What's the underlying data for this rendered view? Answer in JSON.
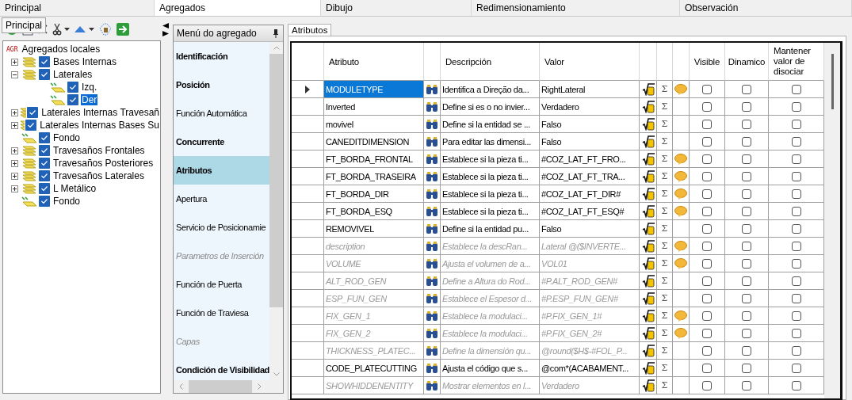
{
  "tabs": [
    {
      "label": "Principal",
      "selected": false
    },
    {
      "label": "Agregados",
      "selected": true
    },
    {
      "label": "Dibujo",
      "selected": false
    },
    {
      "label": "Redimensionamiento",
      "selected": false
    },
    {
      "label": "Observación",
      "selected": false
    }
  ],
  "tooltip": "Principal",
  "tree": {
    "root": {
      "badge": "AGR",
      "label": "Agregados locales"
    },
    "items": [
      {
        "label": "Bases Internas",
        "kind": "group",
        "expanded": false,
        "checked": true,
        "selected": false
      },
      {
        "label": "Laterales",
        "kind": "group",
        "expanded": true,
        "checked": true,
        "selected": false,
        "children": [
          {
            "label": "Izq.",
            "kind": "leaf",
            "checked": true,
            "selected": false
          },
          {
            "label": "Der",
            "kind": "leaf",
            "checked": true,
            "selected": true
          }
        ]
      },
      {
        "label": "Laterales Internas Travesañ",
        "kind": "group",
        "expanded": false,
        "checked": true,
        "selected": false
      },
      {
        "label": "Laterales Internas Bases Su",
        "kind": "group",
        "expanded": false,
        "checked": true,
        "selected": false
      },
      {
        "label": "Fondo",
        "kind": "leaf",
        "checked": true,
        "selected": false
      },
      {
        "label": "Travesaños Frontales",
        "kind": "group",
        "expanded": false,
        "checked": true,
        "selected": false
      },
      {
        "label": "Travesaños Posteriores",
        "kind": "group",
        "expanded": false,
        "checked": true,
        "selected": false
      },
      {
        "label": "Travesaños Laterales",
        "kind": "group",
        "expanded": false,
        "checked": true,
        "selected": false
      },
      {
        "label": "L Metálico",
        "kind": "group",
        "expanded": false,
        "checked": true,
        "selected": false
      },
      {
        "label": "Fondo",
        "kind": "leaf",
        "checked": true,
        "selected": false
      }
    ]
  },
  "menu": {
    "title": "Menú do agregado",
    "items": [
      {
        "label": "Identificación",
        "kind": "bold",
        "selected": false
      },
      {
        "label": "Posición",
        "kind": "bold",
        "selected": false
      },
      {
        "label": "Función Automática",
        "kind": "normal",
        "selected": false
      },
      {
        "label": "Concurrente",
        "kind": "bold",
        "selected": false
      },
      {
        "label": "Atributos",
        "kind": "bold",
        "selected": true
      },
      {
        "label": "Apertura",
        "kind": "normal",
        "selected": false
      },
      {
        "label": "Servicio de Posicionamie",
        "kind": "normal",
        "selected": false
      },
      {
        "label": "Parametros de Inserción",
        "kind": "disabled",
        "selected": false
      },
      {
        "label": "Función de Puerta",
        "kind": "normal",
        "selected": false
      },
      {
        "label": "Función de Traviesa",
        "kind": "normal",
        "selected": false
      },
      {
        "label": "Capas",
        "kind": "disabled",
        "selected": false
      },
      {
        "label": "Condición de Visibilidad",
        "kind": "bold",
        "selected": false
      }
    ]
  },
  "attributes_tab": {
    "label": "Atributos"
  },
  "table": {
    "columns": [
      "Atributo",
      "Descripción",
      "Valor",
      "Visible",
      "Dinamico",
      "Mantener valor de disociar"
    ],
    "rows": [
      {
        "attribute": "MODULETYPE",
        "description": "Identifica a Direção da...",
        "value": "RightLateral",
        "sigma": "Σ",
        "comment": true,
        "inherited": false,
        "selected": true,
        "visible": false,
        "dynamic": false,
        "keep": false
      },
      {
        "attribute": "Inverted",
        "description": "Define si es o no invier...",
        "value": "Verdadero",
        "sigma": "Σ",
        "comment": false,
        "inherited": false,
        "selected": false,
        "visible": false,
        "dynamic": false,
        "keep": false
      },
      {
        "attribute": "movivel",
        "description": "Define si la entidad se ...",
        "value": "Falso",
        "sigma": "Σ",
        "comment": false,
        "inherited": false,
        "selected": false,
        "visible": false,
        "dynamic": false,
        "keep": false
      },
      {
        "attribute": "CANEDITDIMENSION",
        "description": "Para editar las dimensi...",
        "value": "Falso",
        "sigma": "Σ",
        "comment": false,
        "inherited": false,
        "selected": false,
        "visible": false,
        "dynamic": false,
        "keep": false
      },
      {
        "attribute": "FT_BORDA_FRONTAL",
        "description": "Establece si la pieza ti...",
        "value": "#COZ_LAT_FT_FRO...",
        "sigma": "Σ",
        "comment": true,
        "inherited": false,
        "selected": false,
        "visible": false,
        "dynamic": false,
        "keep": false
      },
      {
        "attribute": "FT_BORDA_TRASEIRA",
        "description": "Establece si la pieza ti...",
        "value": "#COZ_LAT_FT_TRA...",
        "sigma": "Σ",
        "comment": true,
        "inherited": false,
        "selected": false,
        "visible": false,
        "dynamic": false,
        "keep": false
      },
      {
        "attribute": "FT_BORDA_DIR",
        "description": "Establece si la pieza ti...",
        "value": "#COZ_LAT_FT_DIR#",
        "sigma": "Σ",
        "comment": true,
        "inherited": false,
        "selected": false,
        "visible": false,
        "dynamic": false,
        "keep": false
      },
      {
        "attribute": "FT_BORDA_ESQ",
        "description": "Establece si la pieza ti...",
        "value": "#COZ_LAT_FT_ESQ#",
        "sigma": "Σ",
        "comment": true,
        "inherited": false,
        "selected": false,
        "visible": false,
        "dynamic": false,
        "keep": false
      },
      {
        "attribute": "REMOVIVEL",
        "description": "Define si la entidad pu...",
        "value": "Falso",
        "sigma": "Σ",
        "comment": false,
        "inherited": false,
        "selected": false,
        "visible": false,
        "dynamic": false,
        "keep": false
      },
      {
        "attribute": "description",
        "description": "Establece la descRan...",
        "value": "Lateral @($INVERTE...",
        "sigma": "Σ",
        "comment": true,
        "inherited": true,
        "selected": false,
        "visible": false,
        "dynamic": false,
        "keep": false
      },
      {
        "attribute": "VOLUME",
        "description": "Ajusta el volumen de a...",
        "value": "VOL01",
        "sigma": "Σ",
        "comment": true,
        "inherited": true,
        "selected": false,
        "visible": false,
        "dynamic": false,
        "keep": false
      },
      {
        "attribute": "ALT_ROD_GEN",
        "description": "Define a Altura do Rod...",
        "value": "#P.ALT_ROD_GEN#",
        "sigma": "Σ",
        "comment": false,
        "inherited": true,
        "selected": false,
        "visible": false,
        "dynamic": false,
        "keep": false
      },
      {
        "attribute": "ESP_FUN_GEN",
        "description": "Establece el Espesor d...",
        "value": "#P.ESP_FUN_GEN#",
        "sigma": "Σ",
        "comment": false,
        "inherited": true,
        "selected": false,
        "visible": false,
        "dynamic": false,
        "keep": false
      },
      {
        "attribute": "FIX_GEN_1",
        "description": "Establece la modulaci...",
        "value": "#P.FIX_GEN_1#",
        "sigma": "Σ",
        "comment": true,
        "inherited": true,
        "selected": false,
        "visible": false,
        "dynamic": false,
        "keep": false
      },
      {
        "attribute": "FIX_GEN_2",
        "description": "Establece la modulaci...",
        "value": "#P.FIX_GEN_2#",
        "sigma": "Σ",
        "comment": true,
        "inherited": true,
        "selected": false,
        "visible": false,
        "dynamic": false,
        "keep": false
      },
      {
        "attribute": "THICKNESS_PLATEC...",
        "description": "Define la dimensión qu...",
        "value": "@round($H$-#FOL_P...",
        "sigma": "Σ",
        "comment": false,
        "inherited": true,
        "selected": false,
        "visible": false,
        "dynamic": false,
        "keep": false
      },
      {
        "attribute": "CODE_PLATECUTTING",
        "description": "Ajusta el código que s...",
        "value": "@com*(ACABAMENT...",
        "sigma": "Σ",
        "comment": false,
        "inherited": false,
        "selected": false,
        "visible": false,
        "dynamic": false,
        "keep": false
      },
      {
        "attribute": "SHOWHIDDENENTITY",
        "description": "Mostrar elementos en l...",
        "value": "Verdadero",
        "sigma": "Σ",
        "comment": false,
        "inherited": true,
        "selected": false,
        "visible": false,
        "dynamic": false,
        "keep": false
      }
    ]
  }
}
